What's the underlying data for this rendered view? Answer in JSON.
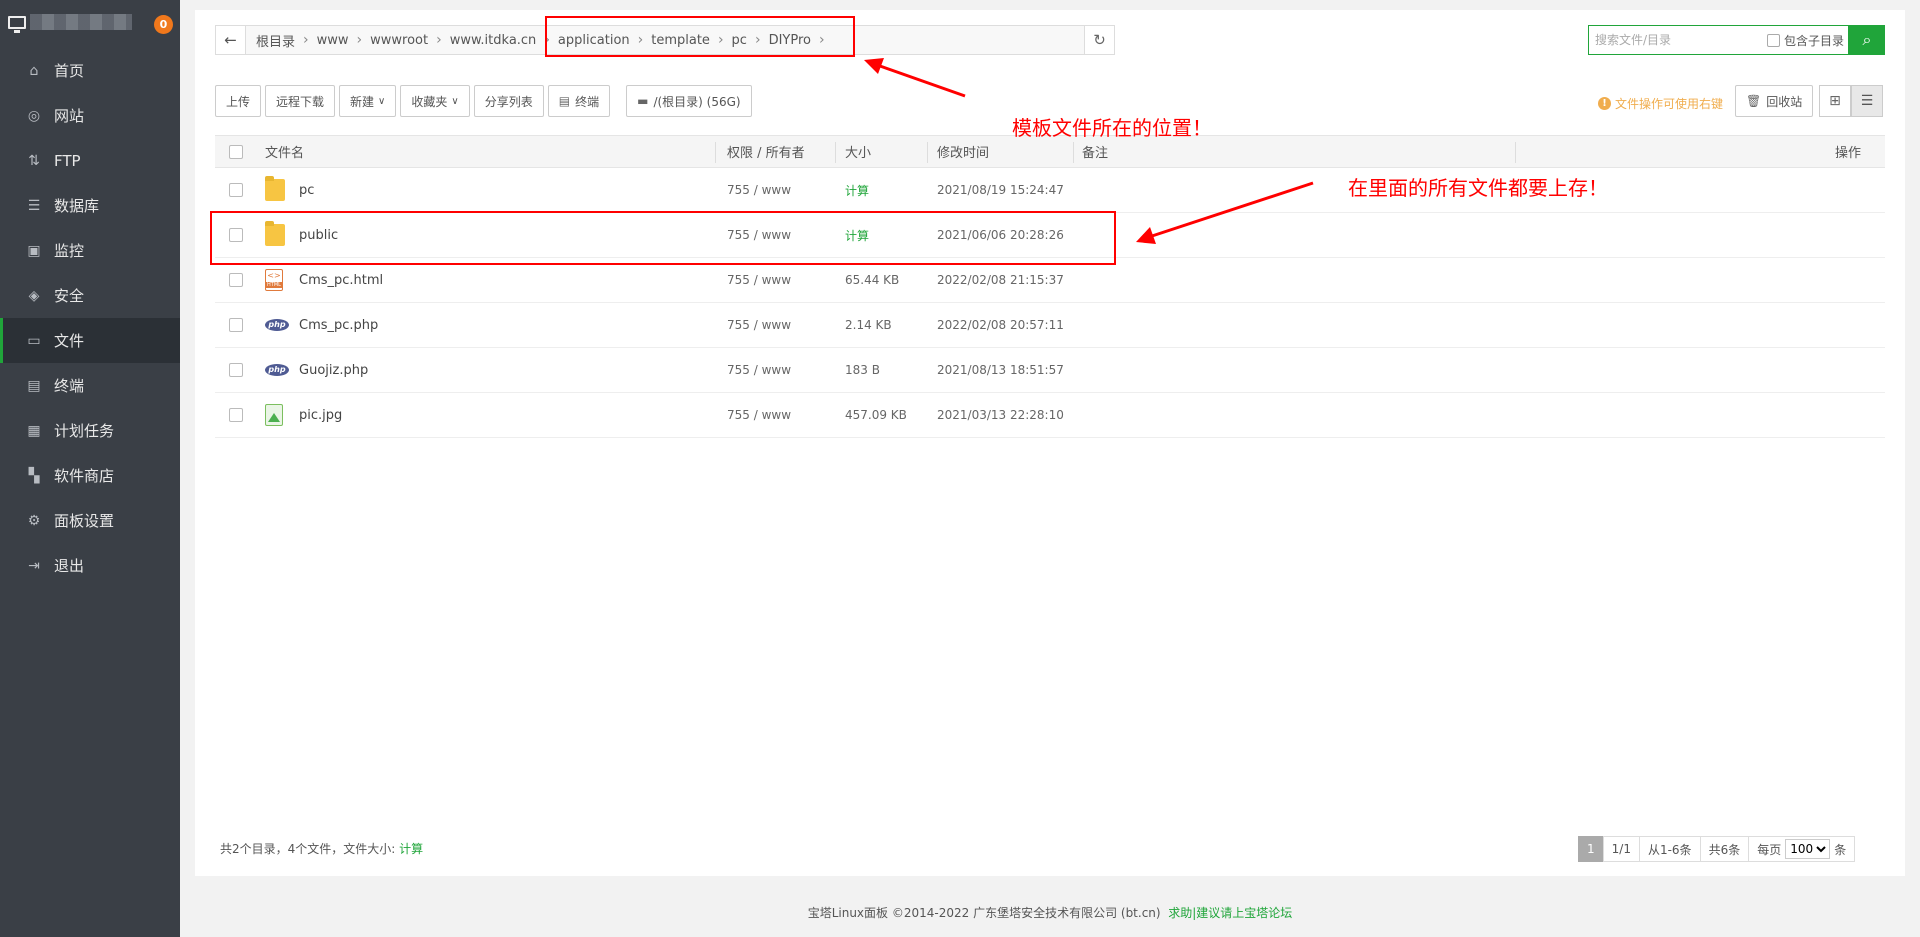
{
  "sidebar": {
    "badge": "0",
    "items": [
      {
        "label": "首页",
        "icon": "home-icon"
      },
      {
        "label": "网站",
        "icon": "globe-icon"
      },
      {
        "label": "FTP",
        "icon": "ftp-icon"
      },
      {
        "label": "数据库",
        "icon": "database-icon"
      },
      {
        "label": "监控",
        "icon": "monitor-icon"
      },
      {
        "label": "安全",
        "icon": "shield-icon"
      },
      {
        "label": "文件",
        "icon": "folder-icon",
        "active": true
      },
      {
        "label": "终端",
        "icon": "terminal-icon"
      },
      {
        "label": "计划任务",
        "icon": "calendar-icon"
      },
      {
        "label": "软件商店",
        "icon": "grid-icon"
      },
      {
        "label": "面板设置",
        "icon": "gear-icon"
      },
      {
        "label": "退出",
        "icon": "logout-icon"
      }
    ]
  },
  "path": {
    "crumbs": [
      "根目录",
      "www",
      "wwwroot",
      "www.itdka.cn",
      "application",
      "template",
      "pc",
      "DIYPro"
    ]
  },
  "search": {
    "placeholder": "搜索文件/目录",
    "include_sub_label": "包含子目录"
  },
  "toolbar": {
    "upload": "上传",
    "remote_download": "远程下载",
    "new": "新建",
    "favorites": "收藏夹",
    "share_list": "分享列表",
    "terminal": "终端",
    "disk": "/(根目录) (56G)"
  },
  "tip": "文件操作可使用右键",
  "recycle": "回收站",
  "table": {
    "headers": {
      "name": "文件名",
      "perm": "权限 / 所有者",
      "size": "大小",
      "mtime": "修改时间",
      "note": "备注",
      "op": "操作"
    },
    "rows": [
      {
        "name": "pc",
        "type": "folder",
        "perm": "755 / www",
        "size": "计算",
        "mtime": "2021/08/19 15:24:47"
      },
      {
        "name": "public",
        "type": "folder",
        "perm": "755 / www",
        "size": "计算",
        "mtime": "2021/06/06 20:28:26"
      },
      {
        "name": "Cms_pc.html",
        "type": "html",
        "perm": "755 / www",
        "size": "65.44 KB",
        "mtime": "2022/02/08 21:15:37"
      },
      {
        "name": "Cms_pc.php",
        "type": "php",
        "perm": "755 / www",
        "size": "2.14 KB",
        "mtime": "2022/02/08 20:57:11"
      },
      {
        "name": "Guojiz.php",
        "type": "php",
        "perm": "755 / www",
        "size": "183 B",
        "mtime": "2021/08/13 18:51:57"
      },
      {
        "name": "pic.jpg",
        "type": "jpg",
        "perm": "755 / www",
        "size": "457.09 KB",
        "mtime": "2021/03/13 22:28:10"
      }
    ]
  },
  "summary": {
    "text": "共2个目录，4个文件，文件大小:",
    "calc": "计算"
  },
  "pager": {
    "current": "1",
    "pages": "1/1",
    "range": "从1-6条",
    "total": "共6条",
    "per_page_label": "每页",
    "per_page": "100",
    "unit": "条"
  },
  "footer": {
    "copyright": "宝塔Linux面板 ©2014-2022 广东堡塔安全技术有限公司 (bt.cn)",
    "link": "求助|建议请上宝塔论坛"
  },
  "annotations": {
    "location": "模板文件所在的位置！",
    "upload_all": "在里面的所有文件都要上存！"
  },
  "colors": {
    "accent": "#20a53a",
    "annotation": "#ff0000",
    "sidebar": "#3a3f46"
  }
}
